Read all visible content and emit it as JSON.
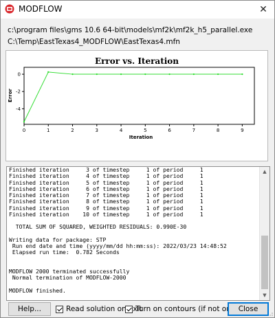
{
  "window": {
    "title": "MODFLOW",
    "close_glyph": "✕"
  },
  "paths": {
    "exe": "c:\\program files\\gms 10.6 64-bit\\models\\mf2k\\mf2k_h5_parallel.exe",
    "mfn": "C:\\Temp\\EastTexas4_MODFLOW\\EastTexas4.mfn"
  },
  "chart_data": {
    "type": "line",
    "title": "Error vs. Iteration",
    "xlabel": "Iteration",
    "ylabel": "Error",
    "x_ticks": [
      "0",
      "1",
      "2",
      "3",
      "4",
      "5",
      "6",
      "7",
      "8",
      "9"
    ],
    "y_ticks": [
      "0",
      "-2",
      "-4"
    ],
    "xlim": [
      0,
      9.5
    ],
    "ylim": [
      -5.8,
      0.8
    ],
    "series": [
      {
        "color": "#33dd33",
        "x": [
          0,
          1,
          2,
          3,
          4,
          5,
          6,
          7,
          8,
          9
        ],
        "y": [
          -5.5,
          0.25,
          0,
          0,
          0,
          0,
          0,
          0,
          0,
          0
        ]
      }
    ],
    "grid": false
  },
  "console": {
    "lines": [
      "Finished iteration     3 of timestep     1 of period     1",
      "Finished iteration     4 of timestep     1 of period     1",
      "Finished iteration     5 of timestep     1 of period     1",
      "Finished iteration     6 of timestep     1 of period     1",
      "Finished iteration     7 of timestep     1 of period     1",
      "Finished iteration     8 of timestep     1 of period     1",
      "Finished iteration     9 of timestep     1 of period     1",
      "Finished iteration    10 of timestep     1 of period     1",
      "",
      "  TOTAL SUM OF SQUARED, WEIGHTED RESIDUALS: 0.990E-30",
      "",
      "Writing data for package: STP",
      " Run end date and time (yyyy/mm/dd hh:mm:ss): 2022/03/23 14:48:52",
      " Elapsed run time:  0.782 Seconds",
      "",
      "",
      "MODFLOW 2000 terminated successfully",
      " Normal termination of MODFLOW-2000",
      "",
      "MODFLOW finished."
    ]
  },
  "buttons": {
    "help": "Help...",
    "close": "Close"
  },
  "checkboxes": {
    "read_solution": {
      "label": "Read solution on exit",
      "checked": true
    },
    "contours": {
      "label": "Turn on contours (if not on already)",
      "checked": true
    }
  },
  "icons": {
    "title": "modflow-app-icon",
    "close": "close-icon"
  }
}
